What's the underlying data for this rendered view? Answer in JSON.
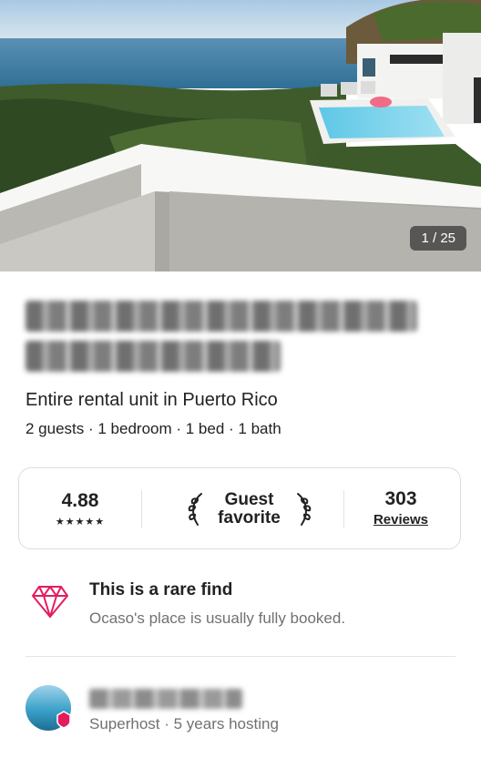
{
  "hero": {
    "photo_counter": "1 / 25"
  },
  "listing": {
    "type": "Entire rental unit in Puerto Rico",
    "details": "2 guests · 1 bedroom · 1 bed · 1 bath"
  },
  "highlights": {
    "rating": "4.88",
    "stars": "★★★★★",
    "guest_favorite": "Guest favorite",
    "reviews_count": "303",
    "reviews_label": "Reviews"
  },
  "rare_find": {
    "title": "This is a rare find",
    "subtitle": "Ocaso's place is usually fully booked."
  },
  "host": {
    "subtitle": "Superhost · 5 years hosting"
  },
  "colors": {
    "accent": "#E31C5F",
    "text": "#222222",
    "muted": "#717171"
  },
  "icons": {
    "rare_find": "diamond-icon",
    "laurel": "laurel-icon"
  }
}
